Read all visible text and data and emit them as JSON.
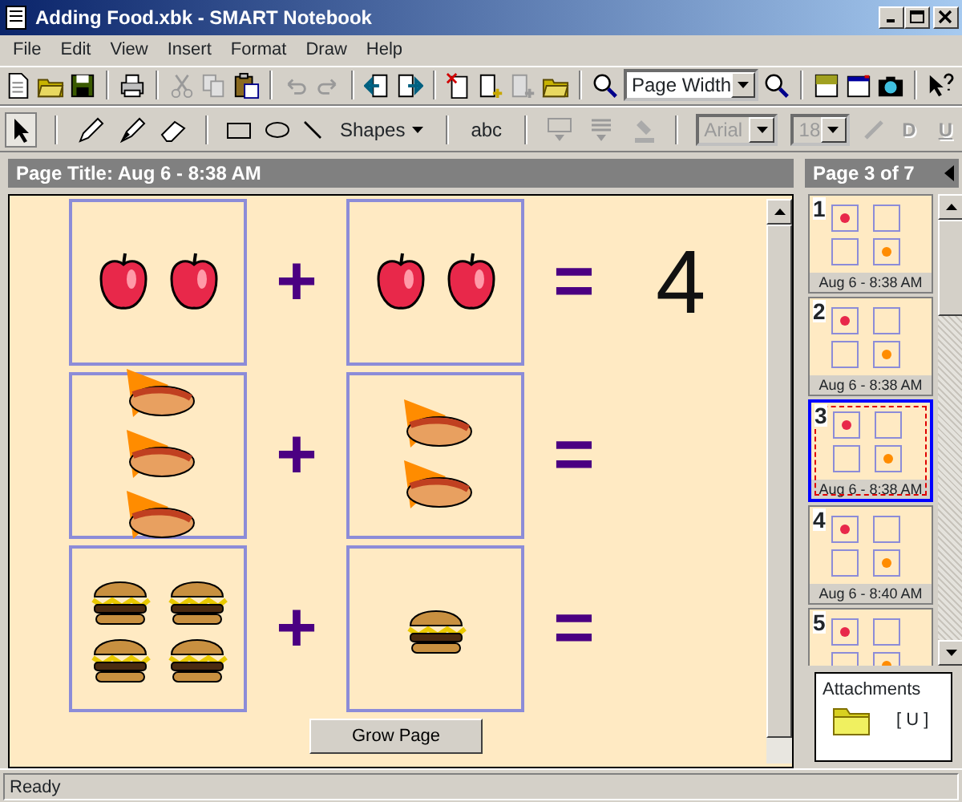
{
  "window": {
    "title": "Adding Food.xbk - SMART Notebook"
  },
  "menu": [
    "File",
    "Edit",
    "View",
    "Insert",
    "Format",
    "Draw",
    "Help"
  ],
  "toolbar": {
    "zoom": "Page Width"
  },
  "drawing_toolbar": {
    "shapes": "Shapes",
    "text_tool": "abc",
    "font": {
      "value": "Arial",
      "disabled": true
    },
    "size": {
      "value": "18",
      "disabled": true
    },
    "style_buttons": [
      {
        "label": "D",
        "disabled": true
      },
      {
        "label": "U",
        "disabled": true
      }
    ]
  },
  "page_title": "Page Title: Aug 6 - 8:38 AM",
  "equations": [
    {
      "left": [
        {
          "kind": "apple"
        },
        {
          "kind": "apple"
        }
      ],
      "right": [
        {
          "kind": "apple"
        },
        {
          "kind": "apple"
        }
      ],
      "plus": "+",
      "equals": "=",
      "answer": "4"
    },
    {
      "left": [
        {
          "kind": "hotdog"
        },
        {
          "kind": "hotdog"
        },
        {
          "kind": "hotdog"
        }
      ],
      "right": [
        {
          "kind": "hotdog"
        },
        {
          "kind": "hotdog"
        }
      ],
      "plus": "+",
      "equals": "="
    },
    {
      "left": [
        {
          "kind": "burger"
        },
        {
          "kind": "burger"
        },
        {
          "kind": "burger"
        },
        {
          "kind": "burger"
        }
      ],
      "right": [
        {
          "kind": "burger"
        }
      ],
      "plus": "+",
      "equals": "="
    }
  ],
  "grow_button": "Grow Page",
  "page_sorter": {
    "header": "Page 3 of 7",
    "pages": [
      {
        "number": "1",
        "caption": "Aug 6 - 8:38 AM",
        "selected": false
      },
      {
        "number": "2",
        "caption": "Aug 6 - 8:38 AM",
        "selected": false
      },
      {
        "number": "3",
        "caption": "Aug 6 - 8:38 AM",
        "selected": true
      },
      {
        "number": "4",
        "caption": "Aug 6 - 8:40 AM",
        "selected": false
      },
      {
        "number": "5",
        "selected": false
      }
    ]
  },
  "attachments": {
    "title": "Attachments",
    "item": "[ U ]"
  },
  "status_bar": "Ready"
}
